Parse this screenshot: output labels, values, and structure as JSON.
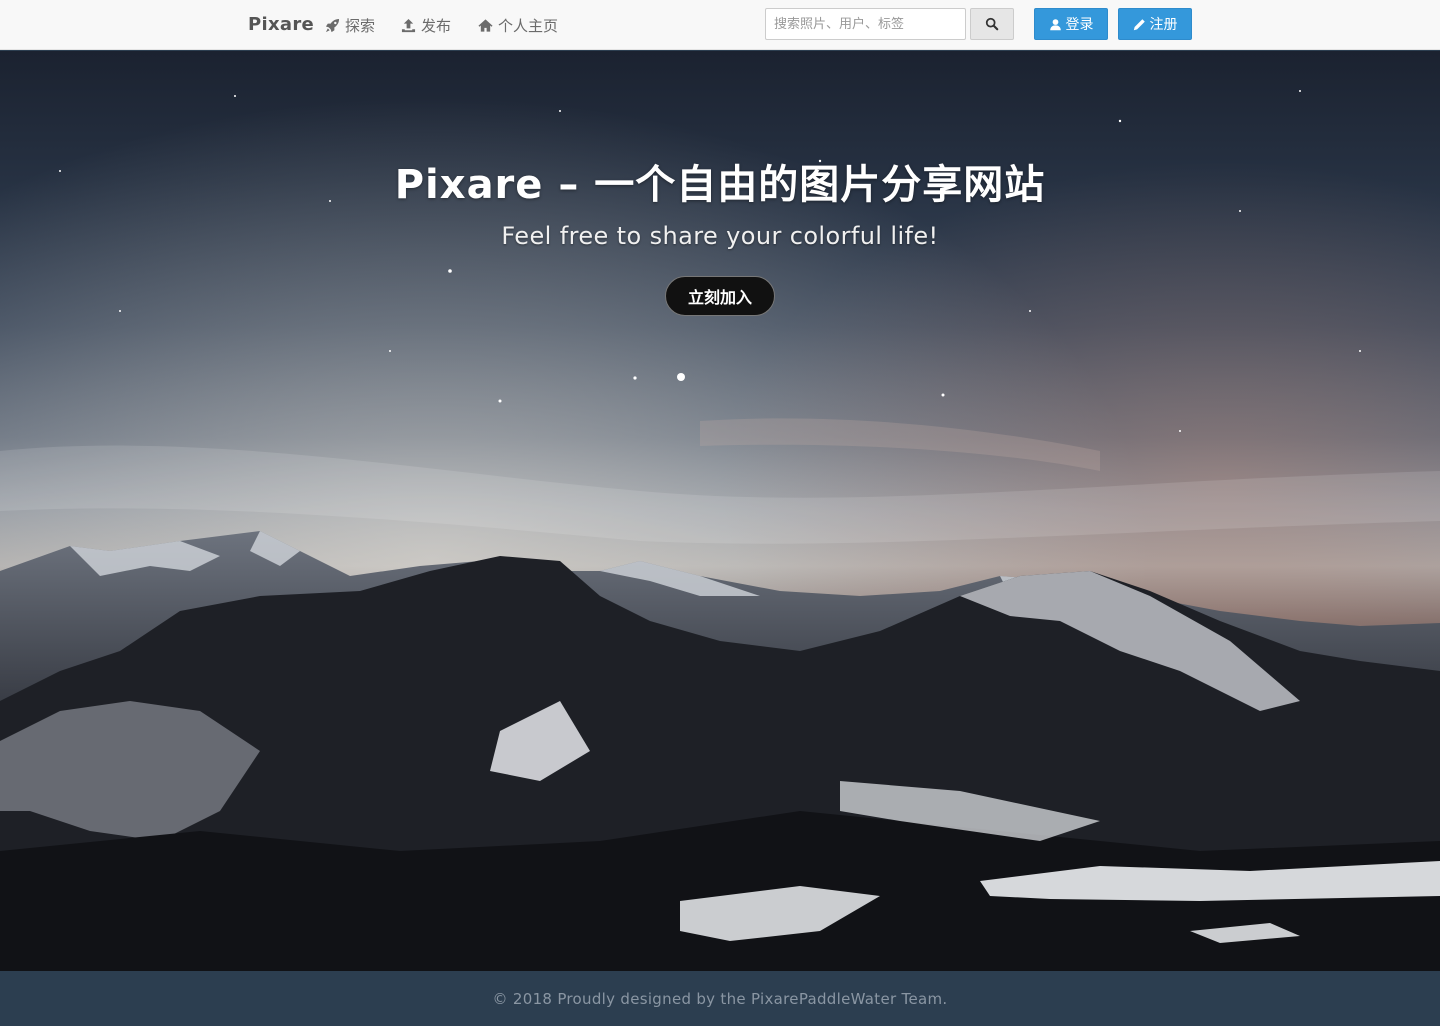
{
  "nav": {
    "brand": "Pixare",
    "items": [
      {
        "label": "探索",
        "icon": "rocket-icon"
      },
      {
        "label": "发布",
        "icon": "upload-icon"
      },
      {
        "label": "个人主页",
        "icon": "home-icon"
      }
    ],
    "search_placeholder": "搜索照片、用户、标签",
    "login_label": "登录",
    "register_label": "注册"
  },
  "hero": {
    "title": "Pixare – 一个自由的图片分享网站",
    "subtitle": "Feel free to share your colorful life!",
    "cta_label": "立刻加入",
    "background": "starry-night-mountains-photo"
  },
  "footer": {
    "text": "© 2018 Proudly designed by the PixarePaddleWater Team."
  },
  "colors": {
    "primary": "#3498db",
    "footer_bg": "#2c3e50",
    "navbar_bg": "#f8f8f8"
  }
}
